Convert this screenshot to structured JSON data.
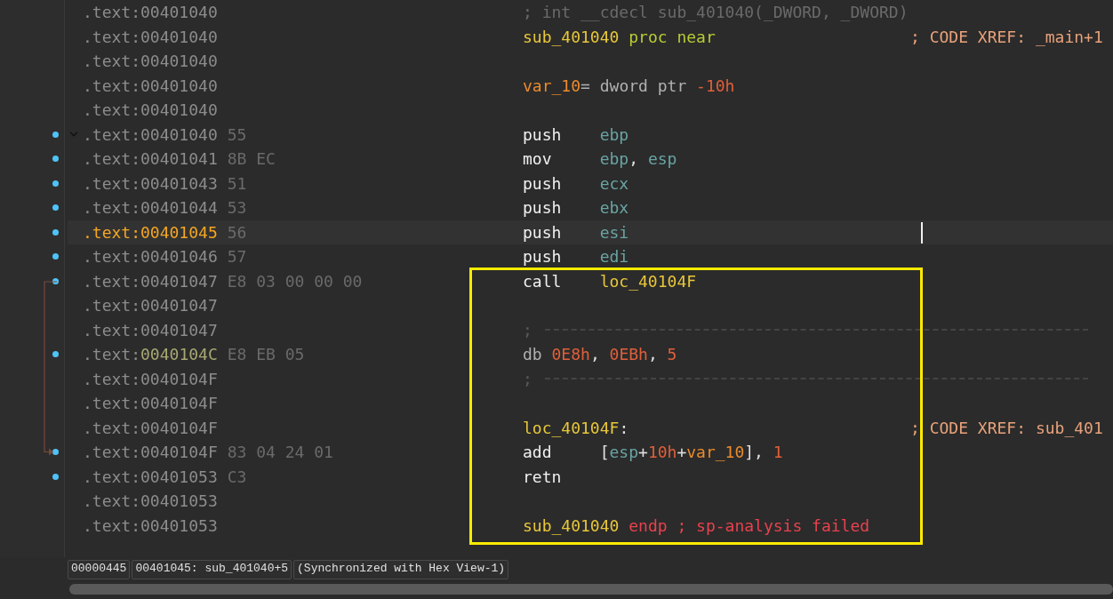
{
  "listing": {
    "rows": [
      {
        "address": ".text:00401040",
        "bytes": "",
        "marked": false,
        "current": false,
        "xref_target": false,
        "tokens": [
          {
            "kind": "muted",
            "text": "; int __cdecl sub_401040(_DWORD, _DWORD)"
          }
        ]
      },
      {
        "address": ".text:00401040",
        "bytes": "",
        "marked": false,
        "current": false,
        "xref_target": false,
        "tokens": [
          {
            "kind": "name",
            "text": "sub_401040"
          },
          {
            "kind": "keyword",
            "text": " proc near"
          }
        ],
        "comment": "; CODE XREF: _main+1"
      },
      {
        "address": ".text:00401040",
        "bytes": "",
        "marked": false,
        "current": false,
        "xref_target": false,
        "tokens": []
      },
      {
        "address": ".text:00401040",
        "bytes": "",
        "marked": false,
        "current": false,
        "xref_target": false,
        "tokens": [
          {
            "kind": "variable",
            "text": "var_10"
          },
          {
            "kind": "plain",
            "text": "= dword ptr "
          },
          {
            "kind": "number",
            "text": "-10h"
          }
        ]
      },
      {
        "address": ".text:00401040",
        "bytes": "",
        "marked": false,
        "current": false,
        "xref_target": false,
        "tokens": []
      },
      {
        "address": ".text:00401040",
        "bytes": "55",
        "marked": true,
        "current": false,
        "xref_target": false,
        "expanded": true,
        "tokens": [
          {
            "kind": "mnemonic",
            "text": "push"
          },
          {
            "kind": "register",
            "text": "ebp"
          }
        ]
      },
      {
        "address": ".text:00401041",
        "bytes": "8B EC",
        "marked": true,
        "current": false,
        "xref_target": false,
        "tokens": [
          {
            "kind": "mnemonic",
            "text": "mov"
          },
          {
            "kind": "register",
            "text": "ebp"
          },
          {
            "kind": "punct",
            "text": ", "
          },
          {
            "kind": "register",
            "text": "esp"
          }
        ]
      },
      {
        "address": ".text:00401043",
        "bytes": "51",
        "marked": true,
        "current": false,
        "xref_target": false,
        "tokens": [
          {
            "kind": "mnemonic",
            "text": "push"
          },
          {
            "kind": "register",
            "text": "ecx"
          }
        ]
      },
      {
        "address": ".text:00401044",
        "bytes": "53",
        "marked": true,
        "current": false,
        "xref_target": false,
        "tokens": [
          {
            "kind": "mnemonic",
            "text": "push"
          },
          {
            "kind": "register",
            "text": "ebx"
          }
        ]
      },
      {
        "address": ".text:00401045",
        "bytes": "56",
        "marked": true,
        "current": true,
        "xref_target": false,
        "tokens": [
          {
            "kind": "mnemonic",
            "text": "push"
          },
          {
            "kind": "register",
            "text": "esi"
          }
        ]
      },
      {
        "address": ".text:00401046",
        "bytes": "57",
        "marked": true,
        "current": false,
        "xref_target": false,
        "tokens": [
          {
            "kind": "mnemonic",
            "text": "push"
          },
          {
            "kind": "register",
            "text": "edi"
          }
        ]
      },
      {
        "address": ".text:00401047",
        "bytes": "E8 03 00 00 00",
        "marked": true,
        "current": false,
        "xref_target": false,
        "jump_source": true,
        "tokens": [
          {
            "kind": "mnemonic",
            "text": "call"
          },
          {
            "kind": "name",
            "text": "loc_40104F"
          }
        ]
      },
      {
        "address": ".text:00401047",
        "bytes": "",
        "marked": false,
        "current": false,
        "xref_target": false,
        "tokens": []
      },
      {
        "address": ".text:00401047",
        "bytes": "",
        "marked": false,
        "current": false,
        "xref_target": false,
        "tokens": [
          {
            "kind": "separator",
            "text": ";"
          }
        ]
      },
      {
        "address": ".text:0040104C",
        "bytes": "E8 EB 05",
        "marked": true,
        "current": false,
        "xref_target": true,
        "tokens": [
          {
            "kind": "plain",
            "text": "db "
          },
          {
            "kind": "number",
            "text": "0E8h"
          },
          {
            "kind": "punct",
            "text": ", "
          },
          {
            "kind": "number",
            "text": "0EBh"
          },
          {
            "kind": "punct",
            "text": ", "
          },
          {
            "kind": "number",
            "text": "5"
          }
        ]
      },
      {
        "address": ".text:0040104F",
        "bytes": "",
        "marked": false,
        "current": false,
        "xref_target": false,
        "tokens": [
          {
            "kind": "separator",
            "text": ";"
          }
        ]
      },
      {
        "address": ".text:0040104F",
        "bytes": "",
        "marked": false,
        "current": false,
        "xref_target": false,
        "tokens": []
      },
      {
        "address": ".text:0040104F",
        "bytes": "",
        "marked": false,
        "current": false,
        "xref_target": false,
        "tokens": [
          {
            "kind": "name",
            "text": "loc_40104F"
          },
          {
            "kind": "punct",
            "text": ":"
          }
        ],
        "comment": "; CODE XREF: sub_401"
      },
      {
        "address": ".text:0040104F",
        "bytes": "83 04 24 01",
        "marked": true,
        "current": false,
        "xref_target": false,
        "jump_target": true,
        "tokens": [
          {
            "kind": "mnemonic",
            "text": "add"
          },
          {
            "kind": "punct",
            "text": "["
          },
          {
            "kind": "register",
            "text": "esp"
          },
          {
            "kind": "punct",
            "text": "+"
          },
          {
            "kind": "number",
            "text": "10h"
          },
          {
            "kind": "punct",
            "text": "+"
          },
          {
            "kind": "variable",
            "text": "var_10"
          },
          {
            "kind": "punct",
            "text": "], "
          },
          {
            "kind": "number",
            "text": "1"
          }
        ]
      },
      {
        "address": ".text:00401053",
        "bytes": "C3",
        "marked": true,
        "current": false,
        "xref_target": false,
        "tokens": [
          {
            "kind": "mnemonic",
            "text": "retn"
          }
        ]
      },
      {
        "address": ".text:00401053",
        "bytes": "",
        "marked": false,
        "current": false,
        "xref_target": false,
        "tokens": []
      },
      {
        "address": ".text:00401053",
        "bytes": "",
        "marked": false,
        "current": false,
        "xref_target": false,
        "tokens": [
          {
            "kind": "name",
            "text": "sub_401040"
          },
          {
            "kind": "error",
            "text": " endp ; sp-analysis failed"
          }
        ]
      }
    ]
  },
  "status_bar": [
    "00000445",
    "00401045: sub_401040+5",
    "(Synchronized with Hex View-1)"
  ]
}
